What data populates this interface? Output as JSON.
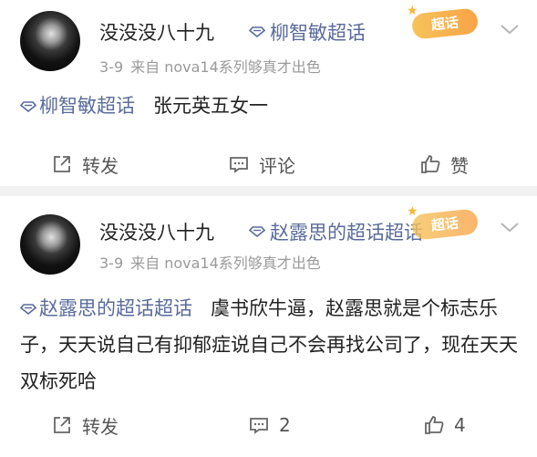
{
  "posts": [
    {
      "username": "没没没八十九",
      "topic": "柳智敏超话",
      "badge": "超话",
      "date": "3-9",
      "source": "来自 nova14系列够真才出色",
      "content_topic": "柳智敏超话",
      "content_text": "张元英五女一",
      "actions": {
        "repost": "转发",
        "comment": "评论",
        "like": "赞"
      }
    },
    {
      "username": "没没没八十九",
      "topic": "赵露思的超话超话",
      "badge": "超话",
      "date": "3-9",
      "source": "来自 nova14系列够真才出色",
      "content_topic": "赵露思的超话超话",
      "content_text": "虞书欣牛逼，赵露思就是个标志乐子，天天说自己有抑郁症说自己不会再找公司了，现在天天双标死哈",
      "actions": {
        "repost": "转发",
        "comment": "2",
        "like": "4"
      }
    }
  ],
  "colors": {
    "topic": "#5a6b9b",
    "badge": "#f7b24f",
    "separator": "#f1f1f1"
  },
  "icons": [
    "diamond-icon",
    "chevron-down-icon",
    "repost-icon",
    "comment-icon",
    "like-icon",
    "avatar"
  ]
}
